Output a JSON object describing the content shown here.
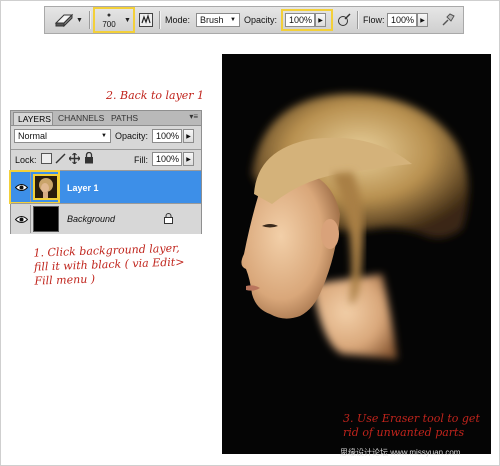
{
  "options_bar": {
    "brush_size": "700",
    "mode_label": "Mode:",
    "mode_value": "Brush",
    "opacity_label": "Opacity:",
    "opacity_value": "100%",
    "flow_label": "Flow:",
    "flow_value": "100%"
  },
  "layers_panel": {
    "tabs": [
      "LAYERS",
      "CHANNELS",
      "PATHS"
    ],
    "active_tab": "LAYERS",
    "blend_mode": "Normal",
    "opacity_label": "Opacity:",
    "opacity_value": "100%",
    "lock_label": "Lock:",
    "fill_label": "Fill:",
    "fill_value": "100%",
    "layers": [
      {
        "name": "Layer 1",
        "selected": true,
        "visible": true
      },
      {
        "name": "Background",
        "selected": false,
        "visible": true,
        "locked": true
      }
    ]
  },
  "annotations": {
    "step1": "1. Click background layer,\nfill it with black ( via Edit>\nFill menu )",
    "step2": "2. Back to layer 1",
    "step3": "3. Use Eraser tool to get\nrid of unwanted parts"
  },
  "watermark": "思缘设计论坛 www.missyuan.com",
  "colors": {
    "accent_highlight": "#f3d03a",
    "selected_layer": "#3d8fe8",
    "annotation_red": "#c0241c"
  }
}
